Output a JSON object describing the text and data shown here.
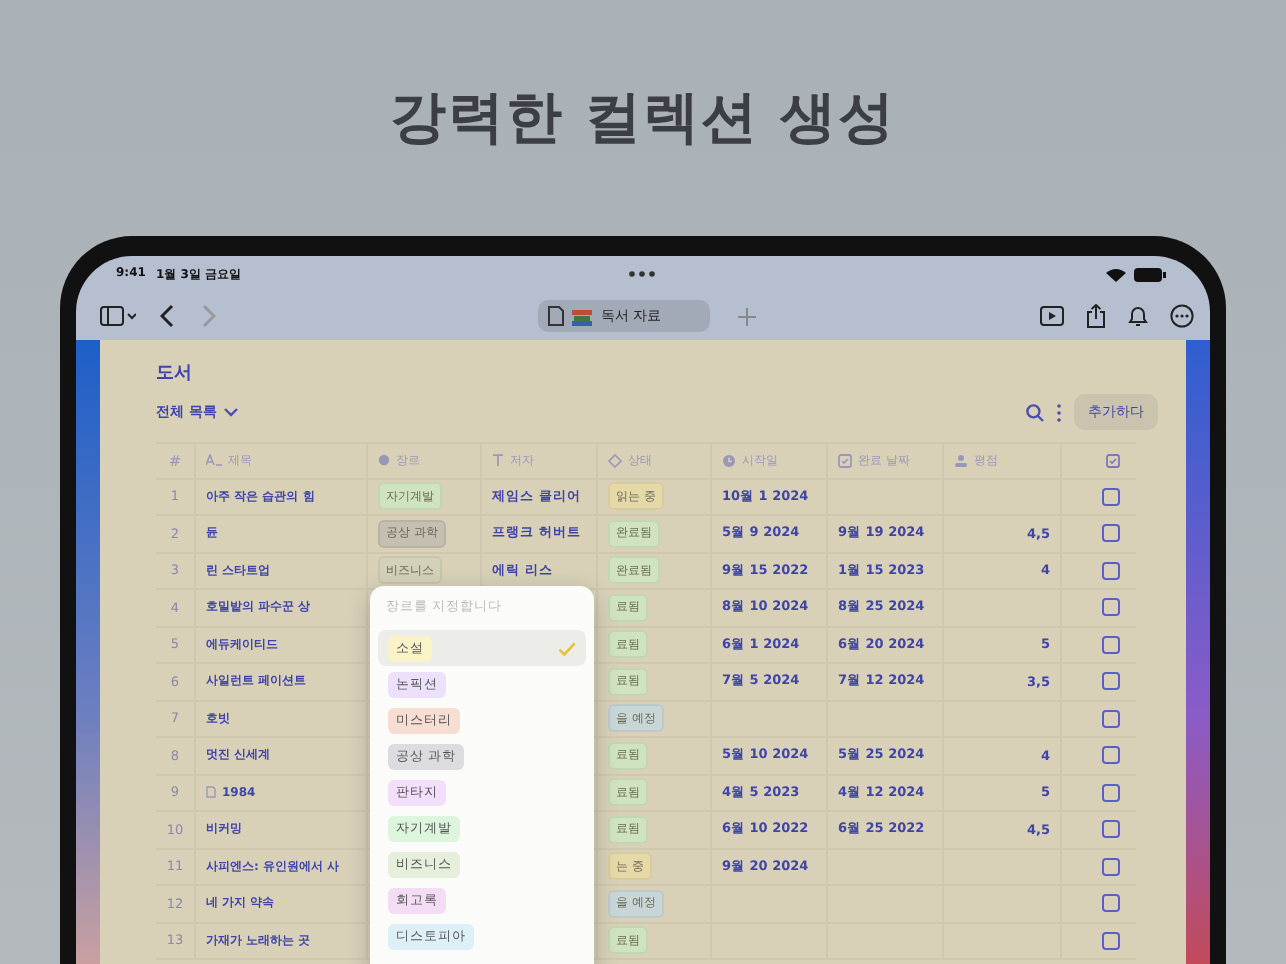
{
  "headline": "강력한 컬렉션 생성",
  "status_bar": {
    "time": "9:41",
    "date": "1월 3일 금요일"
  },
  "toolbar": {
    "tab_title": "독서 자료"
  },
  "collection": {
    "title": "도서",
    "view": "전체 목록",
    "add_button": "추가하다"
  },
  "table": {
    "columns": [
      {
        "kind": "number",
        "label": "#"
      },
      {
        "kind": "text",
        "label": "제목"
      },
      {
        "kind": "select",
        "label": "장르"
      },
      {
        "kind": "author",
        "label": "저자"
      },
      {
        "kind": "status",
        "label": "상태"
      },
      {
        "kind": "date",
        "label": "시작일"
      },
      {
        "kind": "date",
        "label": "완료 날짜"
      },
      {
        "kind": "rating",
        "label": "평점"
      },
      {
        "kind": "check"
      }
    ],
    "rows": [
      {
        "num": "1",
        "title": "아주 작은 습관의 힘",
        "page_icon": false,
        "genre": {
          "label": "자기계발",
          "color": "#cfe3c0"
        },
        "author": "제임스 클리어",
        "status": {
          "label": "읽는 중",
          "color": "#e6d9a8"
        },
        "start": "10월 1 2024",
        "end": "",
        "rating": "",
        "checked": false
      },
      {
        "num": "2",
        "title": "듄",
        "page_icon": false,
        "genre": {
          "label": "공상 과학",
          "color": "#c4bfb0"
        },
        "author": "프랭크 허버트",
        "status": {
          "label": "완료됨",
          "color": "#cfe3c0"
        },
        "start": "5월 9 2024",
        "end": "9월 19 2024",
        "rating": "4,5",
        "checked": false
      },
      {
        "num": "3",
        "title": "린 스타트업",
        "page_icon": false,
        "genre": {
          "label": "비즈니스",
          "color": "#d3d2b8"
        },
        "author": "에릭 리스",
        "status": {
          "label": "완료됨",
          "color": "#cfe3c0"
        },
        "start": "9월 15 2022",
        "end": "1월 15 2023",
        "rating": "4",
        "checked": false
      },
      {
        "num": "4",
        "title": "호밀밭의 파수꾼 상",
        "page_icon": false,
        "status": {
          "label": "료됨",
          "color": "#cfe3c0"
        },
        "start": "8월 10 2024",
        "end": "8월 25 2024",
        "rating": "",
        "checked": false
      },
      {
        "num": "5",
        "title": "에듀케이티드",
        "page_icon": false,
        "status": {
          "label": "료됨",
          "color": "#cfe3c0"
        },
        "start": "6월 1 2024",
        "end": "6월 20 2024",
        "rating": "5",
        "checked": false
      },
      {
        "num": "6",
        "title": "사일런트 페이션트",
        "page_icon": false,
        "status": {
          "label": "료됨",
          "color": "#cfe3c0"
        },
        "start": "7월 5 2024",
        "end": "7월 12 2024",
        "rating": "3,5",
        "checked": false
      },
      {
        "num": "7",
        "title": "호빗",
        "page_icon": false,
        "status": {
          "label": "을 예정",
          "color": "#c9d6d8"
        },
        "start": "",
        "end": "",
        "rating": "",
        "checked": false
      },
      {
        "num": "8",
        "title": "멋진 신세계",
        "page_icon": false,
        "status": {
          "label": "료됨",
          "color": "#cfe3c0"
        },
        "start": "5월 10 2024",
        "end": "5월 25 2024",
        "rating": "4",
        "checked": false
      },
      {
        "num": "9",
        "title": "1984",
        "page_icon": true,
        "status": {
          "label": "료됨",
          "color": "#cfe3c0"
        },
        "start": "4월 5 2023",
        "end": "4월 12 2024",
        "rating": "5",
        "checked": false
      },
      {
        "num": "10",
        "title": "비커밍",
        "page_icon": false,
        "status": {
          "label": "료됨",
          "color": "#cfe3c0"
        },
        "start": "6월 10 2022",
        "end": "6월 25 2022",
        "rating": "4,5",
        "checked": false
      },
      {
        "num": "11",
        "title": "사피엔스: 유인원에서 사",
        "page_icon": false,
        "status": {
          "label": "는 중",
          "color": "#e6d9a8"
        },
        "start": "9월 20 2024",
        "end": "",
        "rating": "",
        "checked": false
      },
      {
        "num": "12",
        "title": "네 가지 약속",
        "page_icon": false,
        "status": {
          "label": "을 예정",
          "color": "#c9d6d8"
        },
        "start": "",
        "end": "",
        "rating": "",
        "checked": false
      },
      {
        "num": "13",
        "title": "가재가 노래하는 곳",
        "page_icon": false,
        "status": {
          "label": "료됨",
          "color": "#cfe3c0"
        },
        "start": "",
        "end": "",
        "rating": "",
        "checked": false
      }
    ]
  },
  "genre_menu": {
    "placeholder": "장르를 지정합니다",
    "options": [
      {
        "label": "소설",
        "color": "#fbf3c8",
        "selected": true
      },
      {
        "label": "논픽션",
        "color": "#ece0fb",
        "selected": false
      },
      {
        "label": "미스터리",
        "color": "#f7ddd2",
        "selected": false
      },
      {
        "label": "공상 과학",
        "color": "#dcdce0",
        "selected": false
      },
      {
        "label": "판타지",
        "color": "#f3defb",
        "selected": false
      },
      {
        "label": "자기계발",
        "color": "#dcf5dc",
        "selected": false
      },
      {
        "label": "비즈니스",
        "color": "#e6eedc",
        "selected": false
      },
      {
        "label": "회고록",
        "color": "#f4dcf4",
        "selected": false
      },
      {
        "label": "디스토피아",
        "color": "#def0f7",
        "selected": false
      }
    ]
  }
}
